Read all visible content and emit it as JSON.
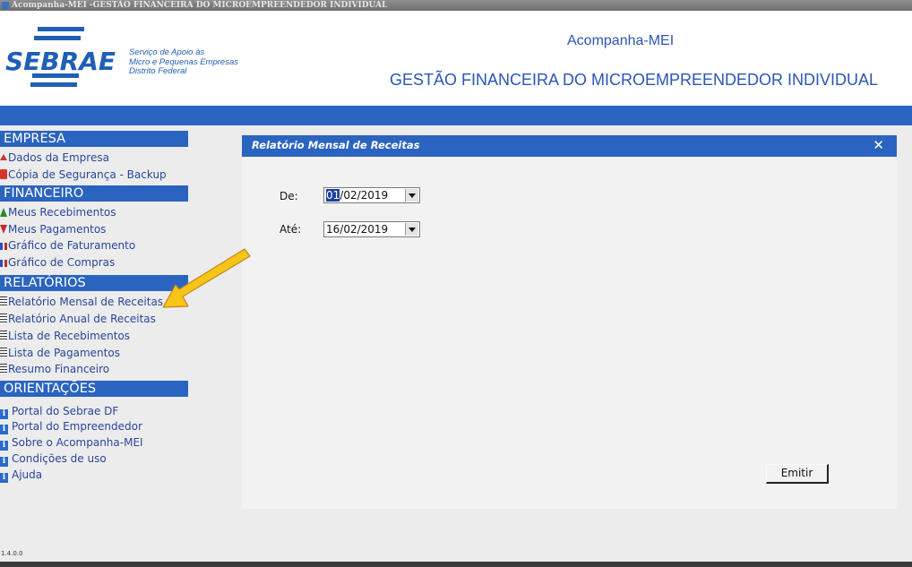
{
  "window": {
    "title": "Acompanha-MEI -GESTÃO FINANCEIRA DO MICROEMPREENDEDOR INDIVIDUAL"
  },
  "header": {
    "logo_word": "SEBRAE",
    "logo_sub_1": "Serviço de Apoio às",
    "logo_sub_2": "Micro e Pequenas Empresas",
    "logo_sub_3": "Distrito Federal",
    "app_name": "Acompanha-MEI",
    "app_subtitle": "GESTÃO FINANCEIRA DO MICROEMPREENDEDOR INDIVIDUAL",
    "accent_color": "#2b64c0"
  },
  "sidebar": {
    "sections": [
      {
        "label": "EMPRESA",
        "items": [
          {
            "label": "Dados da Empresa",
            "icon": "house-icon"
          },
          {
            "label": "Cópia de Segurança - Backup",
            "icon": "backup-icon"
          }
        ]
      },
      {
        "label": "FINANCEIRO",
        "items": [
          {
            "label": "Meus Recebimentos",
            "icon": "arrow-up-icon"
          },
          {
            "label": "Meus Pagamentos",
            "icon": "arrow-down-icon"
          },
          {
            "label": "Gráfico de Faturamento",
            "icon": "chart-icon"
          },
          {
            "label": "Gráfico de Compras",
            "icon": "chart-icon"
          }
        ]
      },
      {
        "label": "RELATÓRIOS",
        "items": [
          {
            "label": "Relatório Mensal de Receitas",
            "icon": "report-icon"
          },
          {
            "label": "Relatório Anual de Receitas",
            "icon": "report-icon"
          },
          {
            "label": "Lista de Recebimentos",
            "icon": "report-icon"
          },
          {
            "label": "Lista de Pagamentos",
            "icon": "report-icon"
          },
          {
            "label": "Resumo Financeiro",
            "icon": "report-icon"
          }
        ]
      },
      {
        "label": "ORIENTAÇÕES",
        "items": [
          {
            "label": "Portal do Sebrae DF",
            "icon": "info-icon"
          },
          {
            "label": "Portal do Empreendedor",
            "icon": "info-icon"
          },
          {
            "label": "Sobre o Acompanha-MEI",
            "icon": "info-icon"
          },
          {
            "label": "Condições de uso",
            "icon": "info-icon"
          },
          {
            "label": "Ajuda",
            "icon": "info-icon"
          }
        ]
      }
    ],
    "version": "1.4.0.0"
  },
  "panel": {
    "title": "Relatório Mensal de Receitas",
    "close_glyph": "✕",
    "from_label": "De:",
    "from_value_selected": "01",
    "from_value_rest": "/02/2019",
    "to_label": "Até:",
    "to_value": "16/02/2019",
    "submit_label": "Emitir"
  },
  "annotation": {
    "arrow_color": "#f5c518"
  }
}
